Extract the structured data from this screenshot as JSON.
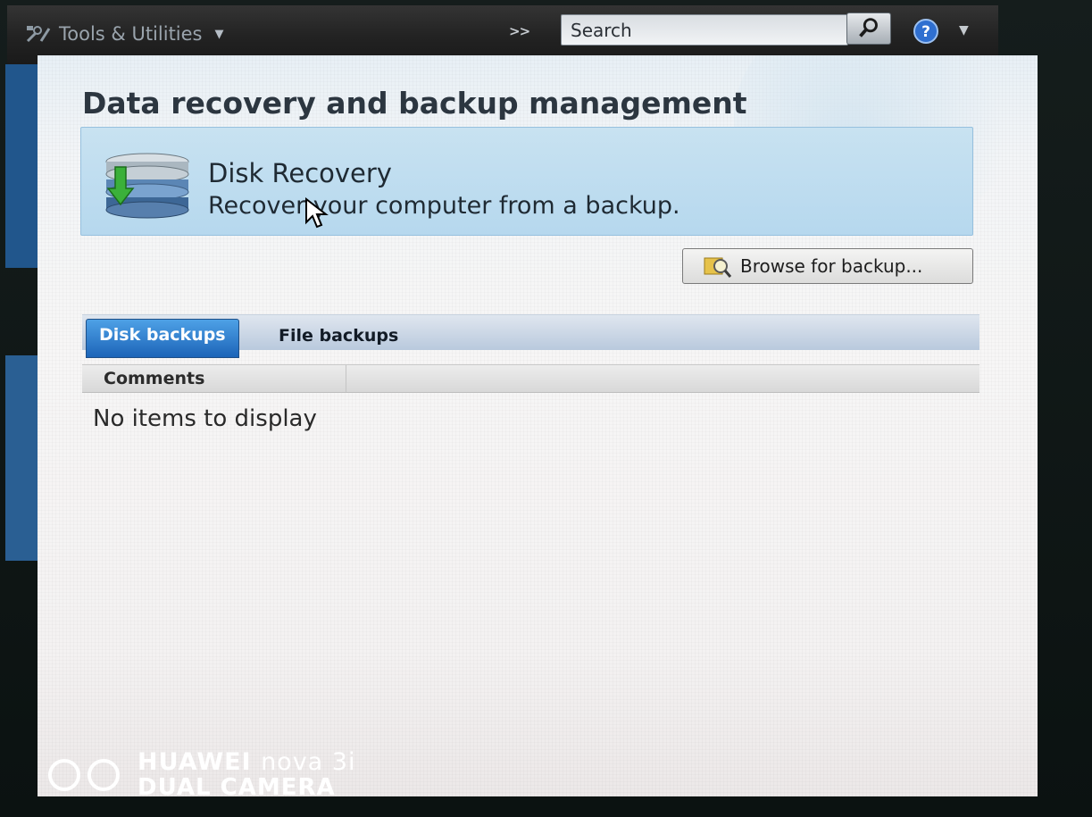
{
  "toolbar": {
    "app_title": "Tools & Utilities",
    "overflow_label": ">>",
    "search_placeholder": "Search",
    "icons": [
      "tools-icon",
      "chevron-down-icon",
      "search-icon",
      "help-icon"
    ]
  },
  "main": {
    "title": "Data recovery and backup management",
    "recovery_task": {
      "title": "Disk Recovery",
      "description": "Recover your computer from a backup.",
      "icon": "disk-stack-icon"
    },
    "browse_button": {
      "label": "Browse for backup...",
      "icon": "browse-magnifier-icon"
    },
    "tabs": [
      {
        "label": "Disk backups",
        "selected": true
      },
      {
        "label": "File backups",
        "selected": false
      }
    ],
    "columns": [
      "Comments"
    ],
    "empty_message": "No items to display"
  },
  "watermark": {
    "brand": "HUAWEI",
    "model": "nova 3i",
    "camera": "DUAL CAMERA"
  },
  "colors": {
    "toolbar_bg": "#222222",
    "task_bg": "#b6d8ee",
    "tab_active": "#1c64b8",
    "nav_blue": "#21568c"
  }
}
